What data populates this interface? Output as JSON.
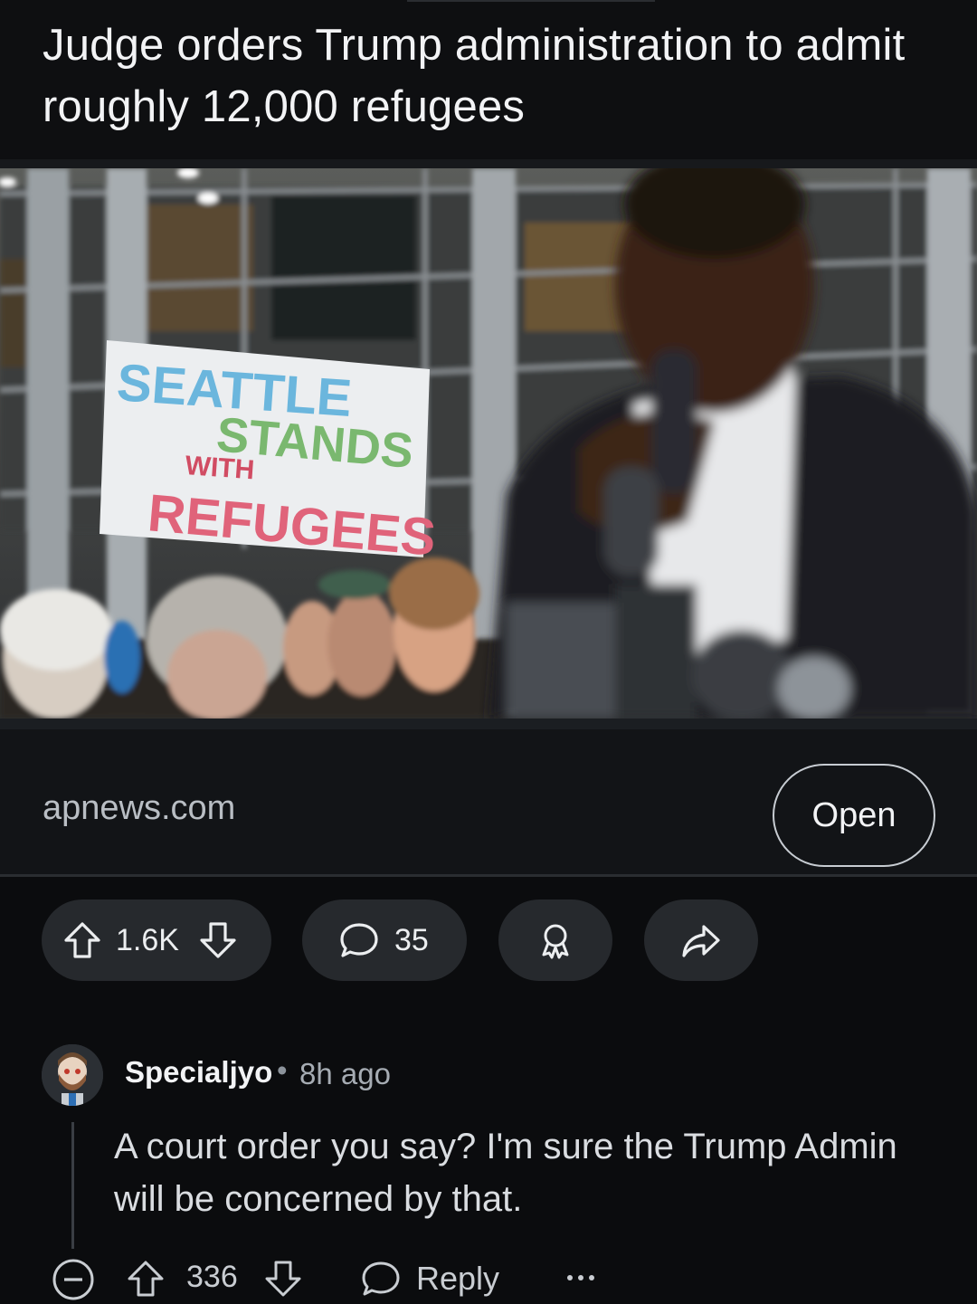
{
  "post": {
    "title": "Judge orders Trump administration to admit roughly 12,000 refugees",
    "image_sign_lines": [
      "SEATTLE",
      "STANDS",
      "WITH",
      "REFUGEES"
    ],
    "link_domain": "apnews.com",
    "open_label": "Open"
  },
  "actions": {
    "score": "1.6K",
    "comment_count": "35"
  },
  "comment": {
    "username": "Specialjyo",
    "separator": "•",
    "time": "8h ago",
    "body": "A court order you say? I'm sure the Trump Admin will be concerned by that.",
    "score": "336",
    "reply_label": "Reply"
  },
  "icons": {
    "upvote": "arrow-up-icon",
    "downvote": "arrow-down-icon",
    "comment": "speech-bubble-icon",
    "award": "award-icon",
    "share": "share-arrow-icon",
    "collapse": "collapse-minus-icon",
    "more": "more-dots-icon"
  },
  "colors": {
    "background": "#0b0c0e",
    "pill": "#26292d",
    "text": "#eceef0",
    "muted": "#a6acb3"
  }
}
